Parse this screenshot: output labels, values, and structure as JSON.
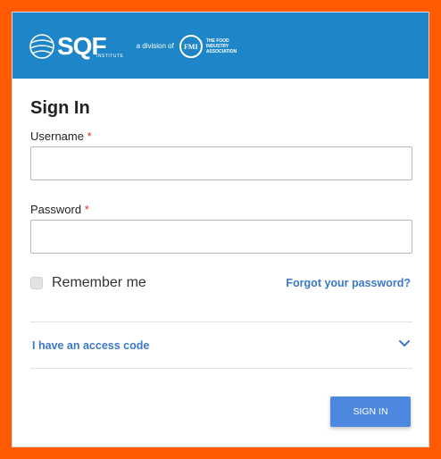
{
  "colors": {
    "frame": "#ff5a00",
    "banner": "#1d85c8",
    "link": "#3b78c9",
    "button": "#4d88e0",
    "required": "#e0342c"
  },
  "header": {
    "logo_text": "SQF",
    "logo_subtext": "INSTITUTE",
    "division_text": "a division of",
    "partner_logo_text": "FMI",
    "partner_name": "THE FOOD\nINDUSTRY\nASSOCIATION"
  },
  "form": {
    "title": "Sign In",
    "username": {
      "label": "Username",
      "required_mark": "*",
      "value": "",
      "placeholder": ""
    },
    "password": {
      "label": "Password",
      "required_mark": "*",
      "value": "",
      "placeholder": ""
    },
    "remember_me": {
      "label": "Remember me",
      "checked": false
    },
    "forgot_link": "Forgot your password?",
    "access_code": {
      "label": "I have an access code",
      "icon": "chevron-down-icon"
    },
    "submit_label": "SIGN IN"
  }
}
